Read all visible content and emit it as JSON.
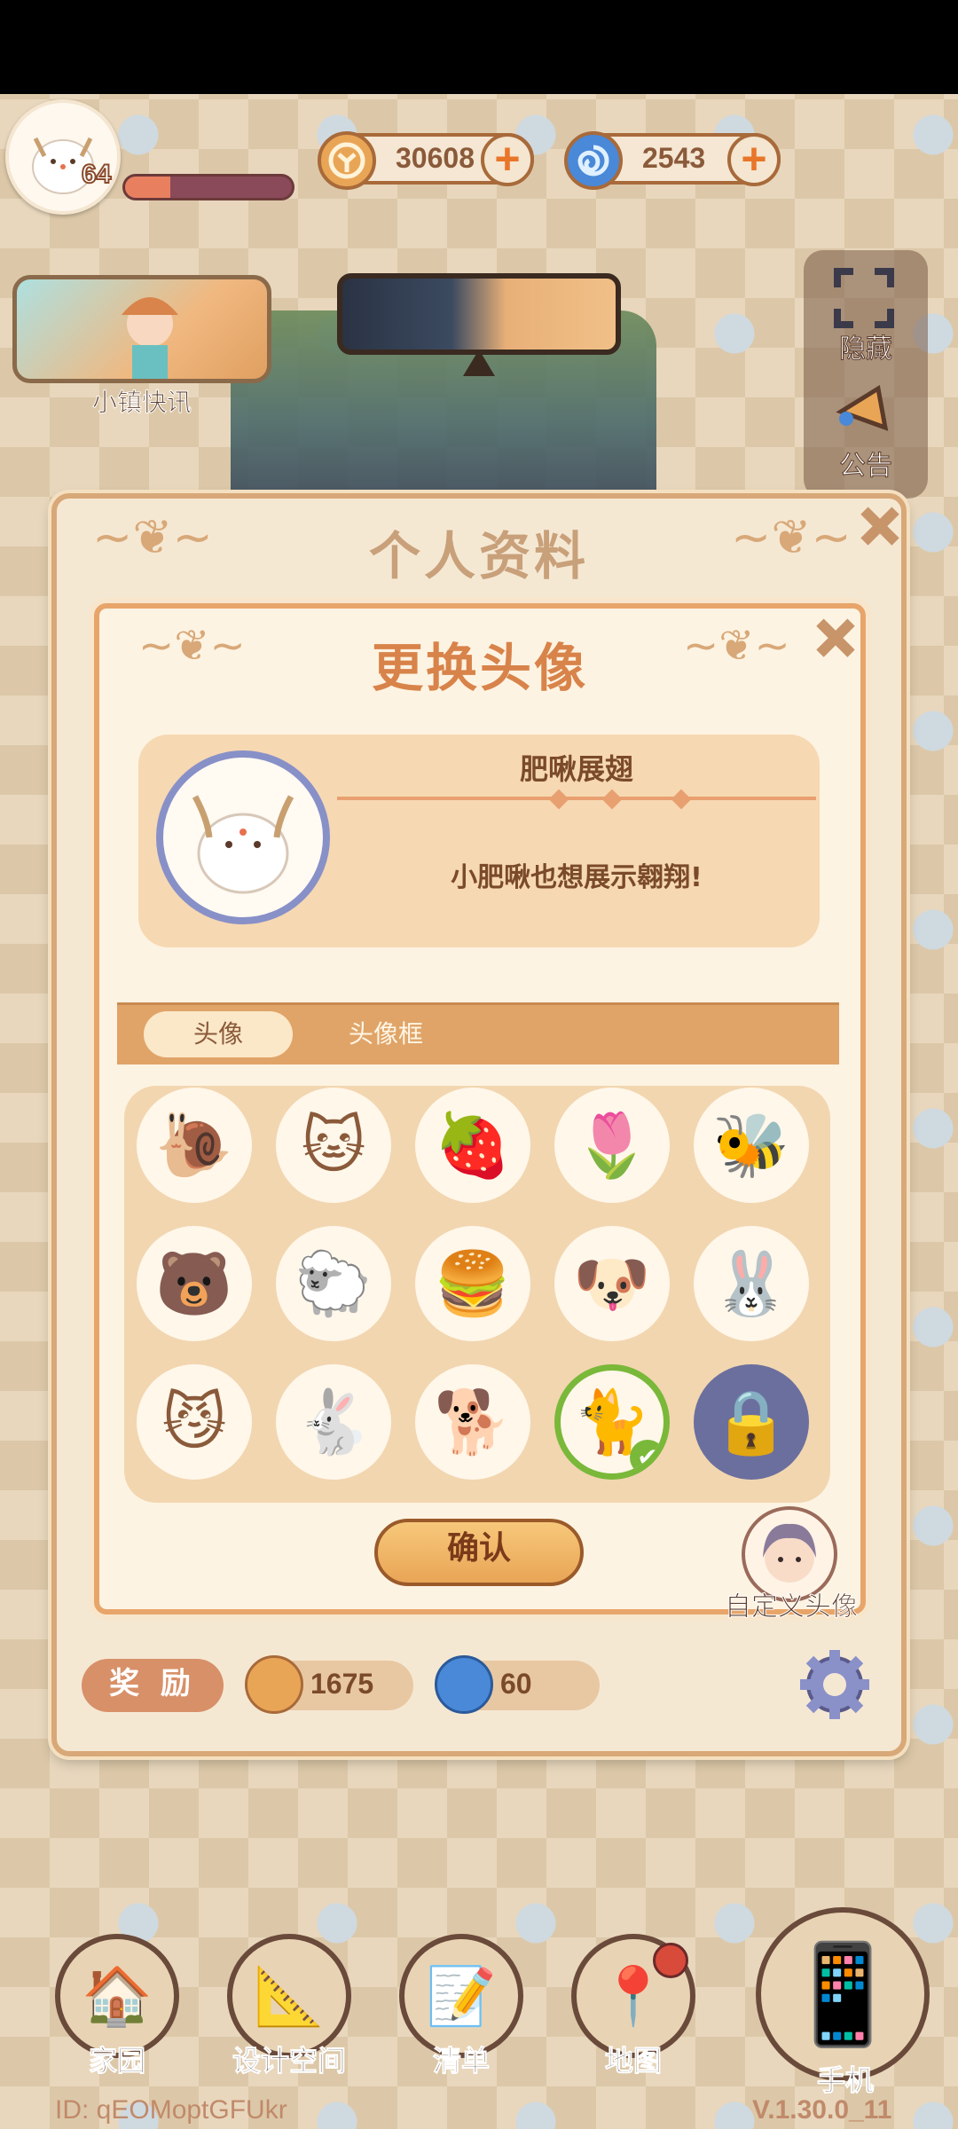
{
  "hud": {
    "level": "64",
    "xp_fraction": 0.27,
    "coins": "30608",
    "gems": "2543",
    "plus": "+"
  },
  "widgets": {
    "news_label": "小镇快讯",
    "hide_label": "隐藏",
    "announce_label": "公告"
  },
  "profile": {
    "title": "个人资料",
    "close": "✕"
  },
  "avatar_dialog": {
    "title": "更换头像",
    "close": "✕",
    "selected_name": "肥啾展翅",
    "selected_desc": "小肥啾也想展示翱翔!",
    "tabs": [
      {
        "label": "头像",
        "active": true
      },
      {
        "label": "头像框",
        "active": false
      }
    ],
    "avatars": [
      {
        "icon": "snail-icon",
        "glyph": "🐌",
        "state": "normal"
      },
      {
        "icon": "gray-cat-icon",
        "glyph": "🐱",
        "state": "normal"
      },
      {
        "icon": "strawberry-icon",
        "glyph": "🍓",
        "state": "normal"
      },
      {
        "icon": "tulip-icon",
        "glyph": "🌷",
        "state": "normal"
      },
      {
        "icon": "bee-icon",
        "glyph": "🐝",
        "state": "normal"
      },
      {
        "icon": "bear-icon",
        "glyph": "🐻",
        "state": "normal"
      },
      {
        "icon": "sheep-icon",
        "glyph": "🐑",
        "state": "normal"
      },
      {
        "icon": "burger-icon",
        "glyph": "🍔",
        "state": "normal"
      },
      {
        "icon": "puppy-icon",
        "glyph": "🐶",
        "state": "normal"
      },
      {
        "icon": "bunny-icon",
        "glyph": "🐰",
        "state": "normal"
      },
      {
        "icon": "bat-cat-icon",
        "glyph": "😼",
        "state": "normal"
      },
      {
        "icon": "white-rabbit-icon",
        "glyph": "🐇",
        "state": "normal"
      },
      {
        "icon": "dog-sunglasses-icon",
        "glyph": "🐕",
        "state": "normal"
      },
      {
        "icon": "leaf-cat-icon",
        "glyph": "🐈",
        "state": "selected"
      },
      {
        "icon": "lock-icon",
        "glyph": "🔒",
        "state": "locked"
      }
    ],
    "confirm_label": "确认",
    "custom_avatar_label": "自定义头像"
  },
  "reward": {
    "label": "奖 励",
    "coins": "1675",
    "gems": "60"
  },
  "nav": [
    {
      "label": "家园",
      "icon": "home-icon",
      "glyph": "🏠"
    },
    {
      "label": "设计空间",
      "icon": "design-icon",
      "glyph": "📐"
    },
    {
      "label": "清单",
      "icon": "list-icon",
      "glyph": "📝"
    },
    {
      "label": "地图",
      "icon": "map-pin-icon",
      "glyph": "📍"
    },
    {
      "label": "手机",
      "icon": "phone-icon",
      "glyph": "📱"
    }
  ],
  "footer": {
    "uid": "ID: qEOMoptGFUkr",
    "version": "V.1.30.0_11"
  },
  "colors": {
    "accent": "#e9a556",
    "panel": "#fdf3e2",
    "title": "#d8834a",
    "selected": "#7ab83a"
  }
}
